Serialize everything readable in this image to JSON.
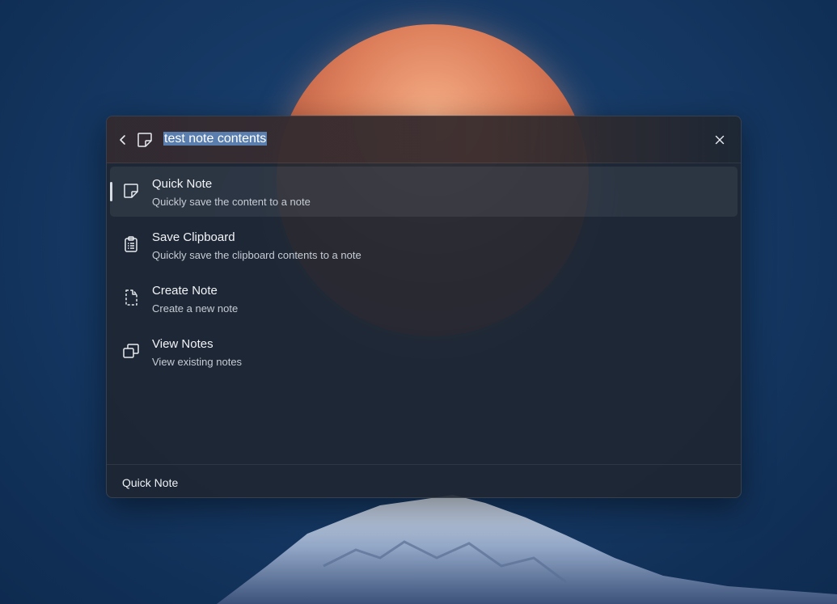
{
  "search": {
    "query": "test note contents"
  },
  "results": [
    {
      "icon": "sticky-note-icon",
      "title": "Quick Note",
      "subtitle": "Quickly save the content to a note",
      "selected": true
    },
    {
      "icon": "clipboard-icon",
      "title": "Save Clipboard",
      "subtitle": "Quickly save the clipboard contents to a note",
      "selected": false
    },
    {
      "icon": "new-document-icon",
      "title": "Create Note",
      "subtitle": "Create a new note",
      "selected": false
    },
    {
      "icon": "stacked-windows-icon",
      "title": "View Notes",
      "subtitle": "View existing notes",
      "selected": false
    }
  ],
  "footer": {
    "label": "Quick Note"
  },
  "colors": {
    "selection_highlight": "#5a7fae",
    "selected_indicator": "#d7dbe2"
  }
}
